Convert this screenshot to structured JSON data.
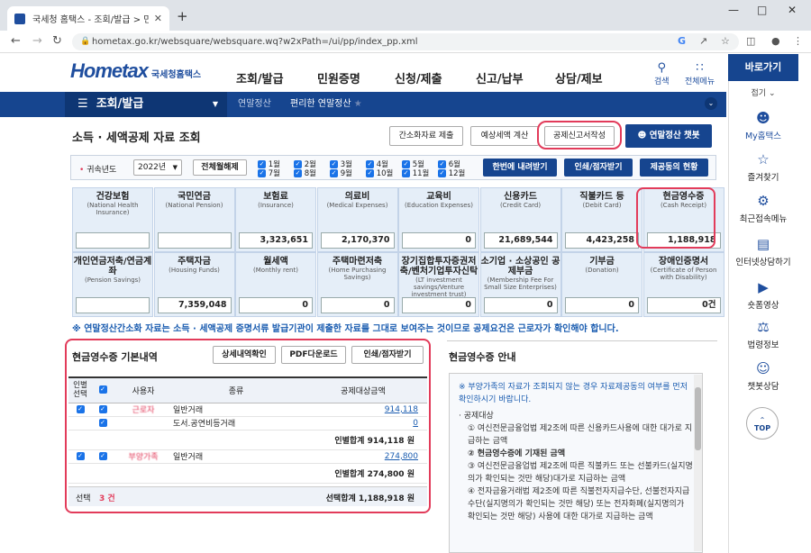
{
  "browser": {
    "tab_title": "국세청 홈택스 - 조회/발급 > 민",
    "url": "hometax.go.kr/websquare/websquare.wq?w2xPath=/ui/pp/index_pp.xml",
    "close": "✕",
    "new_tab": "+"
  },
  "site": {
    "logo_text": "Hometax",
    "logo_sub": "국세청홈택스",
    "menu": [
      "조회/발급",
      "민원증명",
      "신청/제출",
      "신고/납부",
      "상담/제보"
    ],
    "search_label": "검색",
    "allmenu_label": "전체메뉴",
    "nav_home": "조회/발급",
    "crumbs": [
      "연말정산",
      "편리한 연말정산"
    ]
  },
  "sidebar": {
    "title": "바로가기",
    "collapse": "접기",
    "items": [
      "My홈택스",
      "즐겨찾기",
      "최근접속메뉴",
      "인터넷상담하기",
      "숏폼영상",
      "법령정보",
      "챗봇상담"
    ],
    "top": "TOP"
  },
  "page": {
    "title": "소득 · 세액공제 자료 조회",
    "btn_simple": "간소화자료 제출",
    "btn_estimate": "예상세액 계산",
    "btn_deduction": "공제신고서작성",
    "btn_chatbot": "연말정산 챗봇",
    "year_label": "귀속년도",
    "year_value": "2022년",
    "btn_unselect_all": "전체월해제",
    "months": [
      "1월",
      "2월",
      "3월",
      "4월",
      "5월",
      "6월",
      "7월",
      "8월",
      "9월",
      "10월",
      "11월",
      "12월"
    ],
    "btn_download": "한번에 내려받기",
    "btn_print": "인쇄/점자받기",
    "btn_status": "제공동의 현황",
    "notice": "※ 연말정산간소화 자료는 소득 · 세액공제 증명서류 발급기관이 제출한 자료를 그대로 보여주는 것이므로 공제요건은 근로자가 확인해야 합니다."
  },
  "cards": [
    {
      "title": "건강보험",
      "sub": "(National Health Insurance)",
      "value": ""
    },
    {
      "title": "국민연금",
      "sub": "(National Pension)",
      "value": ""
    },
    {
      "title": "보험료",
      "sub": "(Insurance)",
      "value": "3,323,651"
    },
    {
      "title": "의료비",
      "sub": "(Medical Expenses)",
      "value": "2,170,370"
    },
    {
      "title": "교육비",
      "sub": "(Education Expenses)",
      "value": "0"
    },
    {
      "title": "신용카드",
      "sub": "(Credit Card)",
      "value": "21,689,544"
    },
    {
      "title": "직불카드 등",
      "sub": "(Debit Card)",
      "value": "4,423,258"
    },
    {
      "title": "현금영수증",
      "sub": "(Cash Receipt)",
      "value": "1,188,918"
    },
    {
      "title": "개인연금저축/연금계좌",
      "sub": "(Pension Savings)",
      "value": ""
    },
    {
      "title": "주택자금",
      "sub": "(Housing Funds)",
      "value": "7,359,048"
    },
    {
      "title": "월세액",
      "sub": "(Monthly rent)",
      "value": "0"
    },
    {
      "title": "주택마련저축",
      "sub": "(Home Purchasing Savings)",
      "value": "0"
    },
    {
      "title": "장기집합투자증권저축/벤처기업투자신탁",
      "sub": "(LT investment savings/Venture investment trust)",
      "value": "0"
    },
    {
      "title": "소기업 · 소상공인 공제부금",
      "sub": "(Membership Fee For Small Size Enterprises)",
      "value": "0"
    },
    {
      "title": "기부금",
      "sub": "(Donation)",
      "value": "0"
    },
    {
      "title": "장애인증명서",
      "sub": "(Certificate of Person with Disability)",
      "value": "0건"
    }
  ],
  "detail": {
    "title": "현금영수증 기본내역",
    "btn_detail": "상세내역확인",
    "btn_pdf": "PDF다운로드",
    "btn_print": "인쇄/점자받기",
    "headers": [
      "인별 선택",
      "",
      "사용자",
      "종류",
      "공제대상금액"
    ],
    "rows": [
      {
        "user": "근로자",
        "type": "일반거래",
        "amount": "914,118"
      },
      {
        "user": "",
        "type": "도서.공연비등거래",
        "amount": "0"
      },
      {
        "user": "부양가족",
        "type": "일반거래",
        "amount": "274,800"
      }
    ],
    "subtotal1": "인별합계  914,118 원",
    "subtotal2": "인별합계  274,800 원",
    "selected_label": "선택",
    "selected_count": "3 건",
    "selected_total": "선택합계  1,188,918 원"
  },
  "guide": {
    "title": "현금영수증 안내",
    "lines": [
      "※ 부양가족의 자료가 조회되지 않는 경우 자료제공동의 여부를 먼저 확인하시기 바랍니다.",
      "· 공제대상",
      "① 여신전문금융업법 제2조에 따른 신용카드사용에 대한 대가로 지급하는 금액",
      "② 현금영수증에 기재된 금액",
      "③ 여신전문금융업법 제2조에 따른 직불카드 또는 선불카드(실지명의가 확인되는 것만 해당)대가로 지급하는 금액",
      "④ 전자금융거래법 제2조에 따른 직불전자지급수단, 선불전자지급수단(실지명의가 확인되는 것만 해당) 또는 전자화폐(실지명의가 확인되는 것만 해당) 사용에 대한 대가로 지급하는 금액"
    ]
  }
}
